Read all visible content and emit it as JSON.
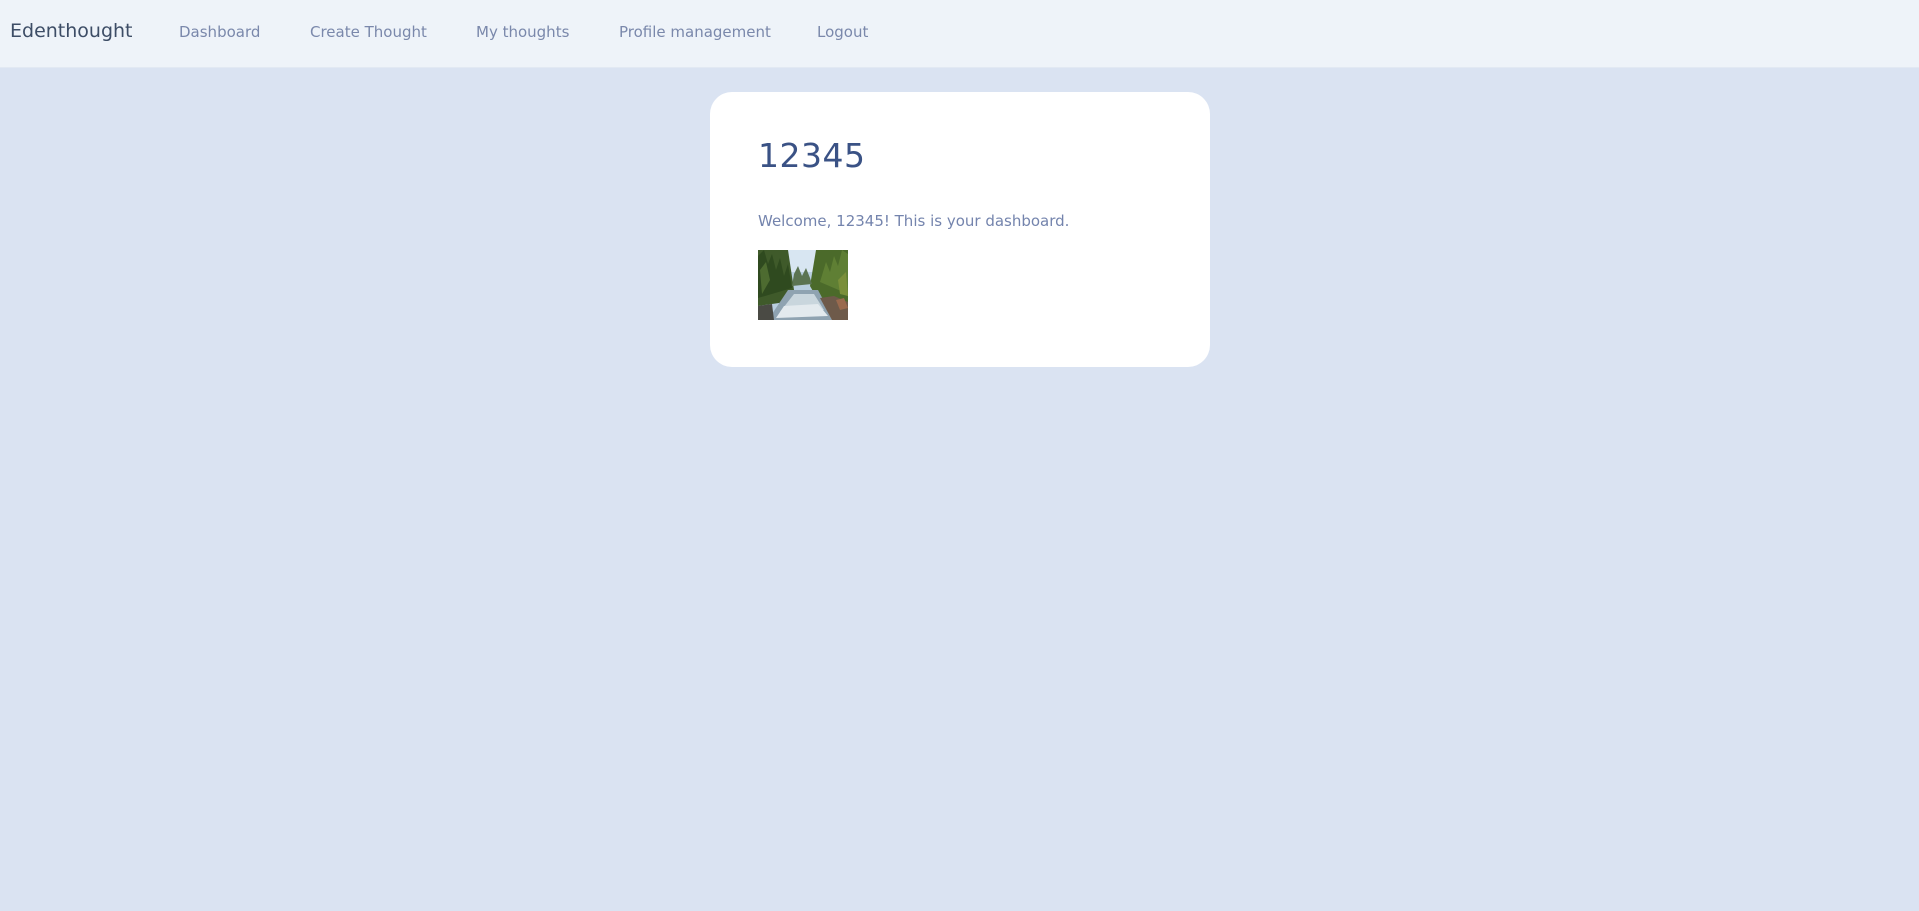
{
  "navbar": {
    "brand": "Edenthought",
    "links": [
      {
        "label": "Dashboard"
      },
      {
        "label": "Create Thought"
      },
      {
        "label": "My thoughts"
      },
      {
        "label": "Profile management"
      },
      {
        "label": "Logout"
      }
    ]
  },
  "card": {
    "title": "12345",
    "welcome": "Welcome, 12345! This is your dashboard.",
    "image_subject": "river-forest-photo"
  },
  "colors": {
    "page_background": "#dae3f2",
    "navbar_background": "#eef3f9",
    "card_background": "#ffffff",
    "title_color": "#3a5285",
    "link_color": "#7a88ab"
  }
}
